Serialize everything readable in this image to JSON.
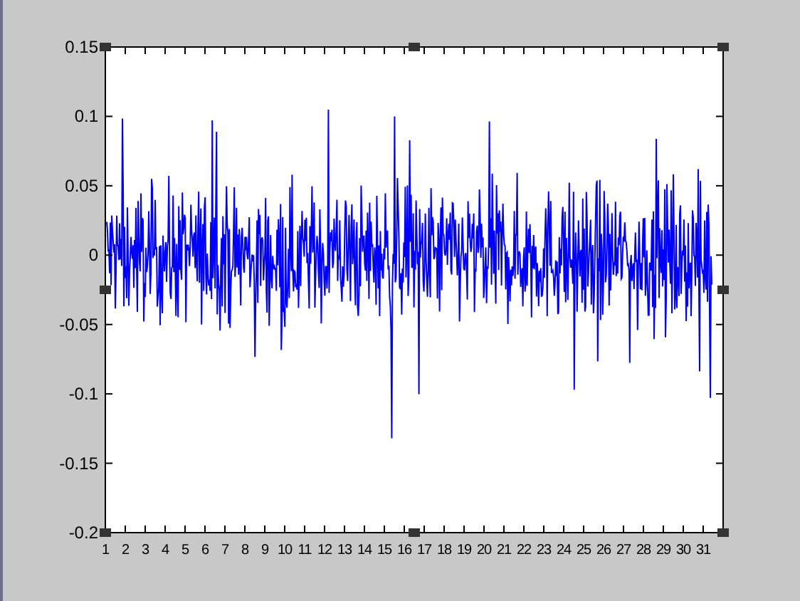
{
  "axes": {
    "selected": true,
    "y_tick_labels": [
      "0.15",
      "0.1",
      "0.05",
      "0",
      "-0.05",
      "-0.1",
      "-0.15",
      "-0.2"
    ],
    "x_tick_labels": [
      "1",
      "2",
      "3",
      "4",
      "5",
      "6",
      "7",
      "8",
      "9",
      "10",
      "11",
      "12",
      "13",
      "14",
      "15",
      "16",
      "17",
      "18",
      "19",
      "20",
      "21",
      "22",
      "23",
      "24",
      "25",
      "26",
      "27",
      "28",
      "29",
      "30",
      "31"
    ]
  }
}
